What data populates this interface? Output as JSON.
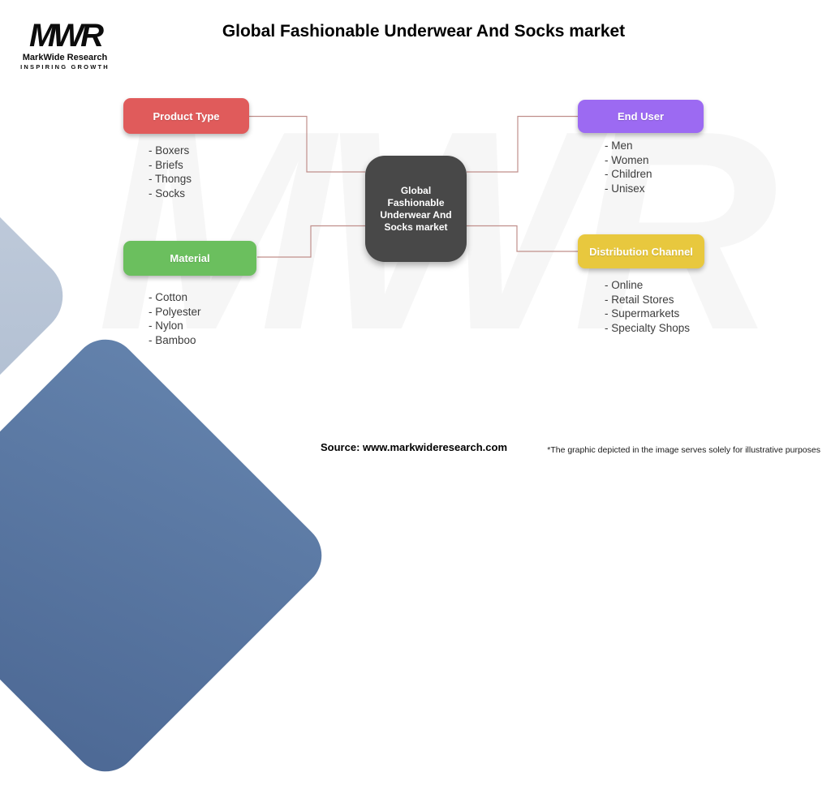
{
  "header": {
    "logo": {
      "mark": "MWR",
      "name": "MarkWide Research",
      "tagline": "INSPIRING GROWTH"
    },
    "title": "Global Fashionable Underwear And Socks market"
  },
  "center_node": {
    "label": "Global Fashionable\nUnderwear And\nSocks market"
  },
  "nodes": [
    {
      "id": "product-type",
      "label": "Product Type",
      "color": "#e05b5b",
      "items": [
        "- Boxers",
        "- Briefs",
        "- Thongs",
        "- Socks"
      ]
    },
    {
      "id": "end-user",
      "label": "End User",
      "color": "#9c6af2",
      "items": [
        "- Men",
        "- Women",
        "- Children",
        "- Unisex"
      ]
    },
    {
      "id": "material",
      "label": "Material",
      "color": "#6bbf5e",
      "items": [
        "- Cotton",
        "- Polyester",
        "- Nylon",
        "- Bamboo"
      ]
    },
    {
      "id": "distribution-channel",
      "label": "Distribution Channel",
      "color": "#e8c83e",
      "items": [
        "- Online",
        "- Retail Stores",
        "- Supermarkets",
        "- Specialty Shops"
      ]
    }
  ],
  "footer": {
    "source": "Source: www.markwideresearch.com",
    "disclaimer": "*The graphic depicted in the image serves solely for illustrative purposes"
  },
  "watermark": "MWR",
  "colors": {
    "connector": "#c08f8b",
    "center_box": "#484848",
    "shape_light_blue": "#b8c4d6",
    "shape_dark_blue": "#5a76a2"
  }
}
